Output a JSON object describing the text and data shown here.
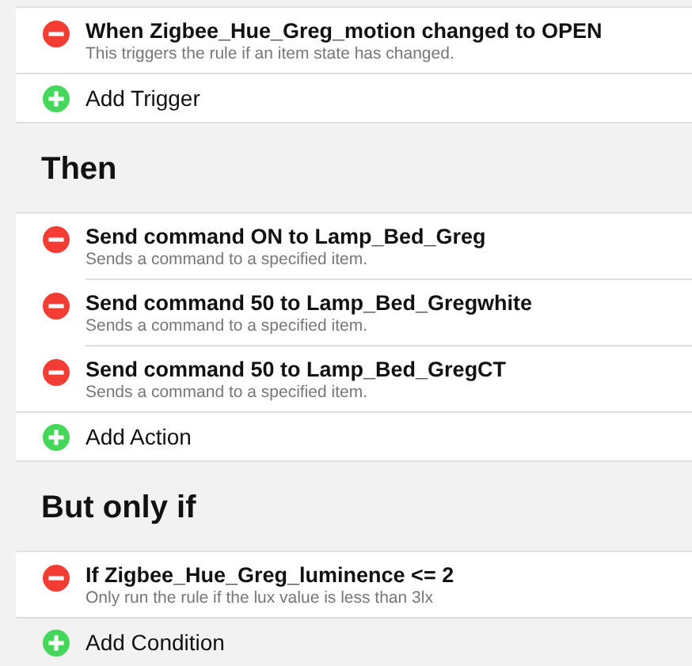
{
  "sections": [
    {
      "items": [
        {
          "title": "When Zigbee_Hue_Greg_motion changed to OPEN",
          "description": "This triggers the rule if an item state has changed."
        }
      ],
      "add": {
        "label": "Add Trigger",
        "highlighted": false
      }
    },
    {
      "heading": "Then",
      "items": [
        {
          "title": "Send command ON to Lamp_Bed_Greg",
          "description": "Sends a command to a specified item."
        },
        {
          "title": "Send command 50 to Lamp_Bed_Gregwhite",
          "description": "Sends a command to a specified item."
        },
        {
          "title": "Send command 50 to Lamp_Bed_GregCT",
          "description": "Sends a command to a specified item."
        }
      ],
      "add": {
        "label": "Add Action",
        "highlighted": false
      }
    },
    {
      "heading": "But only if",
      "items": [
        {
          "title": "If Zigbee_Hue_Greg_luminence <= 2",
          "description": "Only run the rule if the lux value is less than 3lx"
        }
      ],
      "add": {
        "label": "Add Condition",
        "highlighted": true
      }
    }
  ]
}
